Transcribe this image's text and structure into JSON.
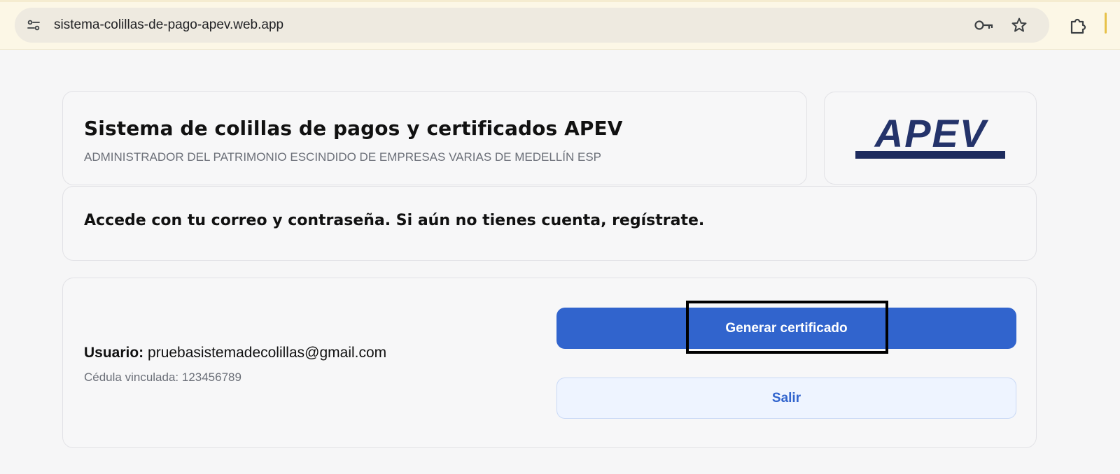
{
  "browser": {
    "url": "sistema-colillas-de-pago-apev.web.app",
    "icons": [
      "site-info-icon",
      "key-icon",
      "star-icon",
      "extensions-icon"
    ]
  },
  "header": {
    "title": "Sistema de colillas de pagos y certificados APEV",
    "subtitle": "ADMINISTRADOR DEL PATRIMONIO ESCINDIDO DE EMPRESAS VARIAS DE MEDELLÍN ESP"
  },
  "logo": {
    "text": "APEV",
    "tagline": "Administrador del Patrimonio Escindido de Empresas Varias de Medellín"
  },
  "notice": {
    "text": "Accede con tu correo y contraseña. Si aún no tienes cuenta, regístrate."
  },
  "user": {
    "label": "Usuario:",
    "email": "pruebasistemadecolillas@gmail.com",
    "cedula": "Cédula vinculada: 123456789"
  },
  "actions": {
    "generate_label": "Generar certificado",
    "exit_label": "Salir"
  },
  "colors": {
    "primary": "#3164cd",
    "secondary_bg": "#eef4ff",
    "logo_navy": "#24336a"
  }
}
